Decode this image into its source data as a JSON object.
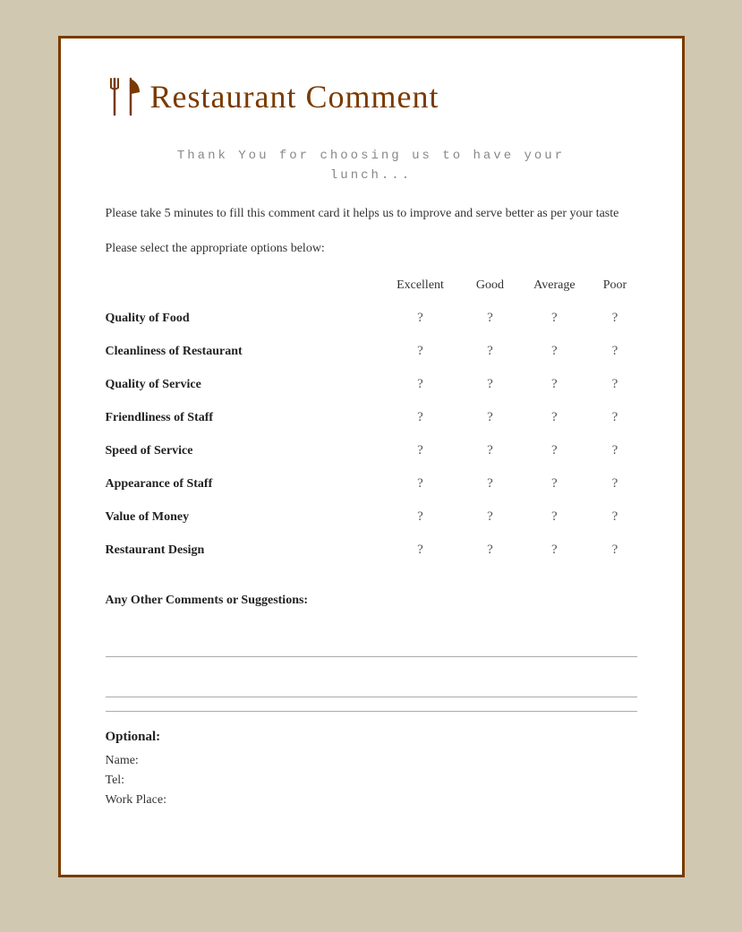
{
  "header": {
    "title": "Restaurant Comment"
  },
  "thank_you": {
    "line1": "Thank You for choosing us to have your",
    "line2": "lunch..."
  },
  "description": "Please take 5 minutes to fill this comment card it helps us to improve and serve better as per your taste",
  "instruction": "Please select the appropriate options below:",
  "table": {
    "columns": [
      "",
      "Excellent",
      "Good",
      "Average",
      "Poor"
    ],
    "rows": [
      {
        "label": "Quality of Food",
        "excellent": "?",
        "good": "?",
        "average": "?",
        "poor": "?"
      },
      {
        "label": "Cleanliness of Restaurant",
        "excellent": "?",
        "good": "?",
        "average": "?",
        "poor": "?"
      },
      {
        "label": "Quality of Service",
        "excellent": "?",
        "good": "?",
        "average": "?",
        "poor": "?"
      },
      {
        "label": "Friendliness of Staff",
        "excellent": "?",
        "good": "?",
        "average": "?",
        "poor": "?"
      },
      {
        "label": "Speed of Service",
        "excellent": "?",
        "good": "?",
        "average": "?",
        "poor": "?"
      },
      {
        "label": "Appearance of Staff",
        "excellent": "?",
        "good": "?",
        "average": "?",
        "poor": "?"
      },
      {
        "label": "Value of Money",
        "excellent": "?",
        "good": "?",
        "average": "?",
        "poor": "?"
      },
      {
        "label": "Restaurant Design",
        "excellent": "?",
        "good": "?",
        "average": "?",
        "poor": "?"
      }
    ]
  },
  "comments": {
    "label": "Any Other Comments or Suggestions:"
  },
  "optional": {
    "title": "Optional:",
    "name_label": "Name:",
    "tel_label": "Tel:",
    "workplace_label": "Work Place:"
  }
}
